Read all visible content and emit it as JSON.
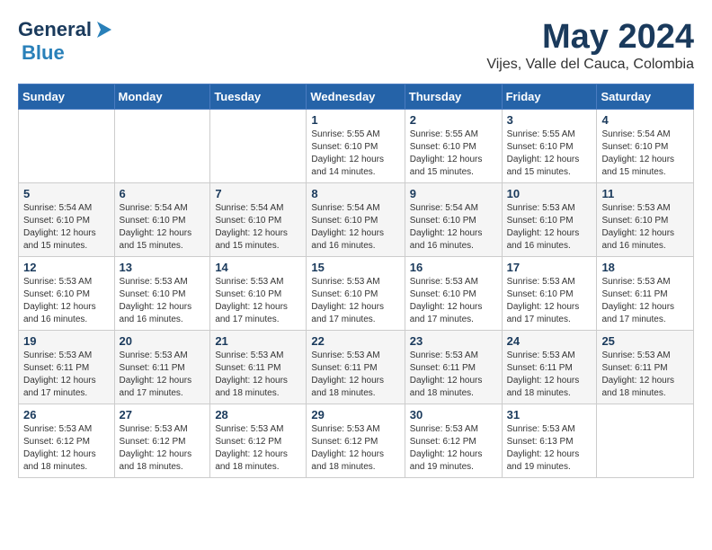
{
  "header": {
    "logo_general": "General",
    "logo_blue": "Blue",
    "title": "May 2024",
    "location": "Vijes, Valle del Cauca, Colombia"
  },
  "weekdays": [
    "Sunday",
    "Monday",
    "Tuesday",
    "Wednesday",
    "Thursday",
    "Friday",
    "Saturday"
  ],
  "weeks": [
    [
      {
        "day": "",
        "sunrise": "",
        "sunset": "",
        "daylight": ""
      },
      {
        "day": "",
        "sunrise": "",
        "sunset": "",
        "daylight": ""
      },
      {
        "day": "",
        "sunrise": "",
        "sunset": "",
        "daylight": ""
      },
      {
        "day": "1",
        "sunrise": "Sunrise: 5:55 AM",
        "sunset": "Sunset: 6:10 PM",
        "daylight": "Daylight: 12 hours and 14 minutes."
      },
      {
        "day": "2",
        "sunrise": "Sunrise: 5:55 AM",
        "sunset": "Sunset: 6:10 PM",
        "daylight": "Daylight: 12 hours and 15 minutes."
      },
      {
        "day": "3",
        "sunrise": "Sunrise: 5:55 AM",
        "sunset": "Sunset: 6:10 PM",
        "daylight": "Daylight: 12 hours and 15 minutes."
      },
      {
        "day": "4",
        "sunrise": "Sunrise: 5:54 AM",
        "sunset": "Sunset: 6:10 PM",
        "daylight": "Daylight: 12 hours and 15 minutes."
      }
    ],
    [
      {
        "day": "5",
        "sunrise": "Sunrise: 5:54 AM",
        "sunset": "Sunset: 6:10 PM",
        "daylight": "Daylight: 12 hours and 15 minutes."
      },
      {
        "day": "6",
        "sunrise": "Sunrise: 5:54 AM",
        "sunset": "Sunset: 6:10 PM",
        "daylight": "Daylight: 12 hours and 15 minutes."
      },
      {
        "day": "7",
        "sunrise": "Sunrise: 5:54 AM",
        "sunset": "Sunset: 6:10 PM",
        "daylight": "Daylight: 12 hours and 15 minutes."
      },
      {
        "day": "8",
        "sunrise": "Sunrise: 5:54 AM",
        "sunset": "Sunset: 6:10 PM",
        "daylight": "Daylight: 12 hours and 16 minutes."
      },
      {
        "day": "9",
        "sunrise": "Sunrise: 5:54 AM",
        "sunset": "Sunset: 6:10 PM",
        "daylight": "Daylight: 12 hours and 16 minutes."
      },
      {
        "day": "10",
        "sunrise": "Sunrise: 5:53 AM",
        "sunset": "Sunset: 6:10 PM",
        "daylight": "Daylight: 12 hours and 16 minutes."
      },
      {
        "day": "11",
        "sunrise": "Sunrise: 5:53 AM",
        "sunset": "Sunset: 6:10 PM",
        "daylight": "Daylight: 12 hours and 16 minutes."
      }
    ],
    [
      {
        "day": "12",
        "sunrise": "Sunrise: 5:53 AM",
        "sunset": "Sunset: 6:10 PM",
        "daylight": "Daylight: 12 hours and 16 minutes."
      },
      {
        "day": "13",
        "sunrise": "Sunrise: 5:53 AM",
        "sunset": "Sunset: 6:10 PM",
        "daylight": "Daylight: 12 hours and 16 minutes."
      },
      {
        "day": "14",
        "sunrise": "Sunrise: 5:53 AM",
        "sunset": "Sunset: 6:10 PM",
        "daylight": "Daylight: 12 hours and 17 minutes."
      },
      {
        "day": "15",
        "sunrise": "Sunrise: 5:53 AM",
        "sunset": "Sunset: 6:10 PM",
        "daylight": "Daylight: 12 hours and 17 minutes."
      },
      {
        "day": "16",
        "sunrise": "Sunrise: 5:53 AM",
        "sunset": "Sunset: 6:10 PM",
        "daylight": "Daylight: 12 hours and 17 minutes."
      },
      {
        "day": "17",
        "sunrise": "Sunrise: 5:53 AM",
        "sunset": "Sunset: 6:10 PM",
        "daylight": "Daylight: 12 hours and 17 minutes."
      },
      {
        "day": "18",
        "sunrise": "Sunrise: 5:53 AM",
        "sunset": "Sunset: 6:11 PM",
        "daylight": "Daylight: 12 hours and 17 minutes."
      }
    ],
    [
      {
        "day": "19",
        "sunrise": "Sunrise: 5:53 AM",
        "sunset": "Sunset: 6:11 PM",
        "daylight": "Daylight: 12 hours and 17 minutes."
      },
      {
        "day": "20",
        "sunrise": "Sunrise: 5:53 AM",
        "sunset": "Sunset: 6:11 PM",
        "daylight": "Daylight: 12 hours and 17 minutes."
      },
      {
        "day": "21",
        "sunrise": "Sunrise: 5:53 AM",
        "sunset": "Sunset: 6:11 PM",
        "daylight": "Daylight: 12 hours and 18 minutes."
      },
      {
        "day": "22",
        "sunrise": "Sunrise: 5:53 AM",
        "sunset": "Sunset: 6:11 PM",
        "daylight": "Daylight: 12 hours and 18 minutes."
      },
      {
        "day": "23",
        "sunrise": "Sunrise: 5:53 AM",
        "sunset": "Sunset: 6:11 PM",
        "daylight": "Daylight: 12 hours and 18 minutes."
      },
      {
        "day": "24",
        "sunrise": "Sunrise: 5:53 AM",
        "sunset": "Sunset: 6:11 PM",
        "daylight": "Daylight: 12 hours and 18 minutes."
      },
      {
        "day": "25",
        "sunrise": "Sunrise: 5:53 AM",
        "sunset": "Sunset: 6:11 PM",
        "daylight": "Daylight: 12 hours and 18 minutes."
      }
    ],
    [
      {
        "day": "26",
        "sunrise": "Sunrise: 5:53 AM",
        "sunset": "Sunset: 6:12 PM",
        "daylight": "Daylight: 12 hours and 18 minutes."
      },
      {
        "day": "27",
        "sunrise": "Sunrise: 5:53 AM",
        "sunset": "Sunset: 6:12 PM",
        "daylight": "Daylight: 12 hours and 18 minutes."
      },
      {
        "day": "28",
        "sunrise": "Sunrise: 5:53 AM",
        "sunset": "Sunset: 6:12 PM",
        "daylight": "Daylight: 12 hours and 18 minutes."
      },
      {
        "day": "29",
        "sunrise": "Sunrise: 5:53 AM",
        "sunset": "Sunset: 6:12 PM",
        "daylight": "Daylight: 12 hours and 18 minutes."
      },
      {
        "day": "30",
        "sunrise": "Sunrise: 5:53 AM",
        "sunset": "Sunset: 6:12 PM",
        "daylight": "Daylight: 12 hours and 19 minutes."
      },
      {
        "day": "31",
        "sunrise": "Sunrise: 5:53 AM",
        "sunset": "Sunset: 6:13 PM",
        "daylight": "Daylight: 12 hours and 19 minutes."
      },
      {
        "day": "",
        "sunrise": "",
        "sunset": "",
        "daylight": ""
      }
    ]
  ]
}
